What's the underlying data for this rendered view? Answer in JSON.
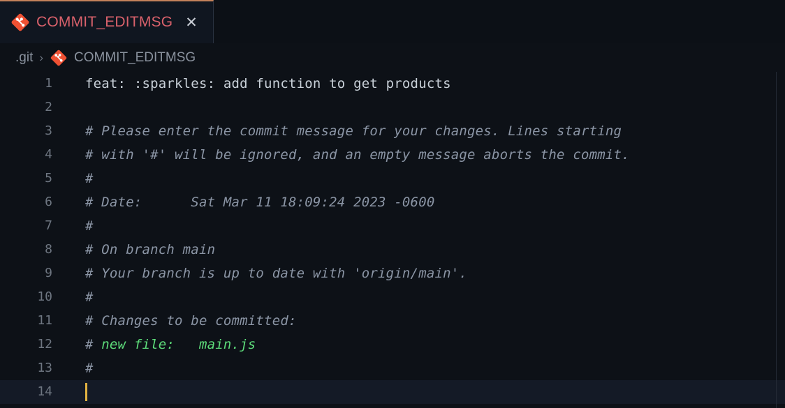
{
  "tab": {
    "label": "COMMIT_EDITMSG",
    "icon": "git-file-icon",
    "close_label": "✕",
    "active_border_color": "#c4815a",
    "label_color": "#d9616b"
  },
  "breadcrumb": {
    "folder": ".git",
    "separator": "›",
    "icon": "git-file-icon",
    "file": "COMMIT_EDITMSG"
  },
  "editor": {
    "active_line": 14,
    "cursor_color": "#e3b341",
    "comment_color": "#8b95a5",
    "text_color": "#c9d1d9",
    "added_file_color": "#5ddc7a",
    "lines": [
      {
        "num": "1",
        "type": "text",
        "text": "feat: :sparkles: add function to get products"
      },
      {
        "num": "2",
        "type": "text",
        "text": ""
      },
      {
        "num": "3",
        "type": "comment",
        "text": "# Please enter the commit message for your changes. Lines starting"
      },
      {
        "num": "4",
        "type": "comment",
        "text": "# with '#' will be ignored, and an empty message aborts the commit."
      },
      {
        "num": "5",
        "type": "comment",
        "text": "#"
      },
      {
        "num": "6",
        "type": "comment",
        "text": "# Date:      Sat Mar 11 18:09:24 2023 -0600"
      },
      {
        "num": "7",
        "type": "comment",
        "text": "#"
      },
      {
        "num": "8",
        "type": "comment",
        "text": "# On branch main"
      },
      {
        "num": "9",
        "type": "comment",
        "text": "# Your branch is up to date with 'origin/main'."
      },
      {
        "num": "10",
        "type": "comment",
        "text": "#"
      },
      {
        "num": "11",
        "type": "comment",
        "text": "# Changes to be committed:"
      },
      {
        "num": "12",
        "type": "split",
        "prefix": "# ",
        "accent": "new file:   main.js"
      },
      {
        "num": "13",
        "type": "comment",
        "text": "#"
      },
      {
        "num": "14",
        "type": "text",
        "text": ""
      }
    ]
  }
}
